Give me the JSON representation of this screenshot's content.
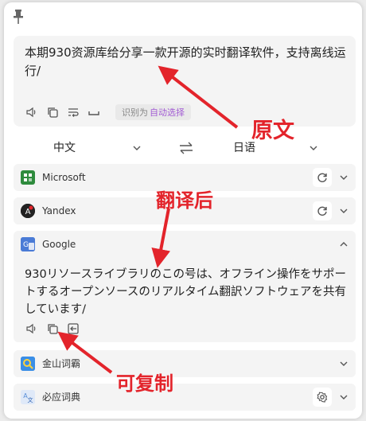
{
  "source": {
    "text": "本期930资源库给分享一款开源的实时翻译软件，支持离线运行/",
    "detect_label": "识别为",
    "detect_value": "自动选择"
  },
  "languages": {
    "source": "中文",
    "target": "日语"
  },
  "services": [
    {
      "name": "Microsoft",
      "logo_color": "#2e8b3d"
    },
    {
      "name": "Yandex",
      "logo_color": "#222222"
    },
    {
      "name": "Google",
      "logo_color": "#4a7bd6"
    },
    {
      "name": "金山词霸",
      "logo_color": "#3a8ee6"
    },
    {
      "name": "必应词典",
      "logo_color": "#5a8fd8"
    }
  ],
  "google_result": "930リソースライブラリのこの号は、オフライン操作をサポートするオープンソースのリアルタイム翻訳ソフトウェアを共有しています/",
  "annotations": {
    "original": "原文",
    "translated": "翻译后",
    "copyable": "可复制"
  },
  "colors": {
    "annotation": "#e3242b",
    "detect_accent": "#a25bd4"
  }
}
